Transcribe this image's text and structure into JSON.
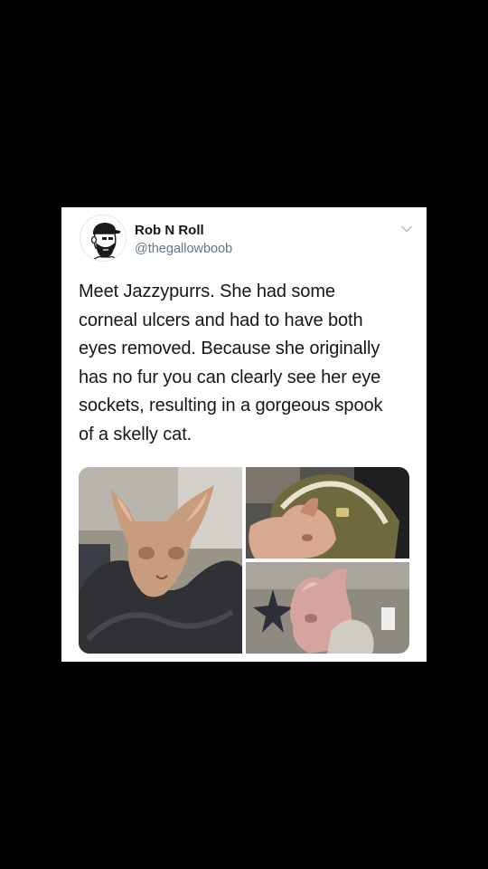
{
  "tweet": {
    "user": {
      "name": "Rob N Roll",
      "handle": "@thegallowboob",
      "avatar_icon": "bearded-man-cap-avatar"
    },
    "menu_icon": "chevron-down-icon",
    "text": "Meet Jazzypurrs. She had some\ncorneal ulcers and had to have both\neyes removed. Because she originally\nhas no fur you can clearly see her eye\nsockets, resulting in a gorgeous spook\nof a skelly cat.",
    "media": [
      {
        "subject": "hairless cat in grey blanket"
      },
      {
        "subject": "hairless cat in olive hoodie"
      },
      {
        "subject": "hairless cat close-up near wall"
      }
    ]
  },
  "colors": {
    "background": "#000000",
    "card": "#ffffff",
    "text": "#14171a",
    "secondary_text": "#657786"
  }
}
